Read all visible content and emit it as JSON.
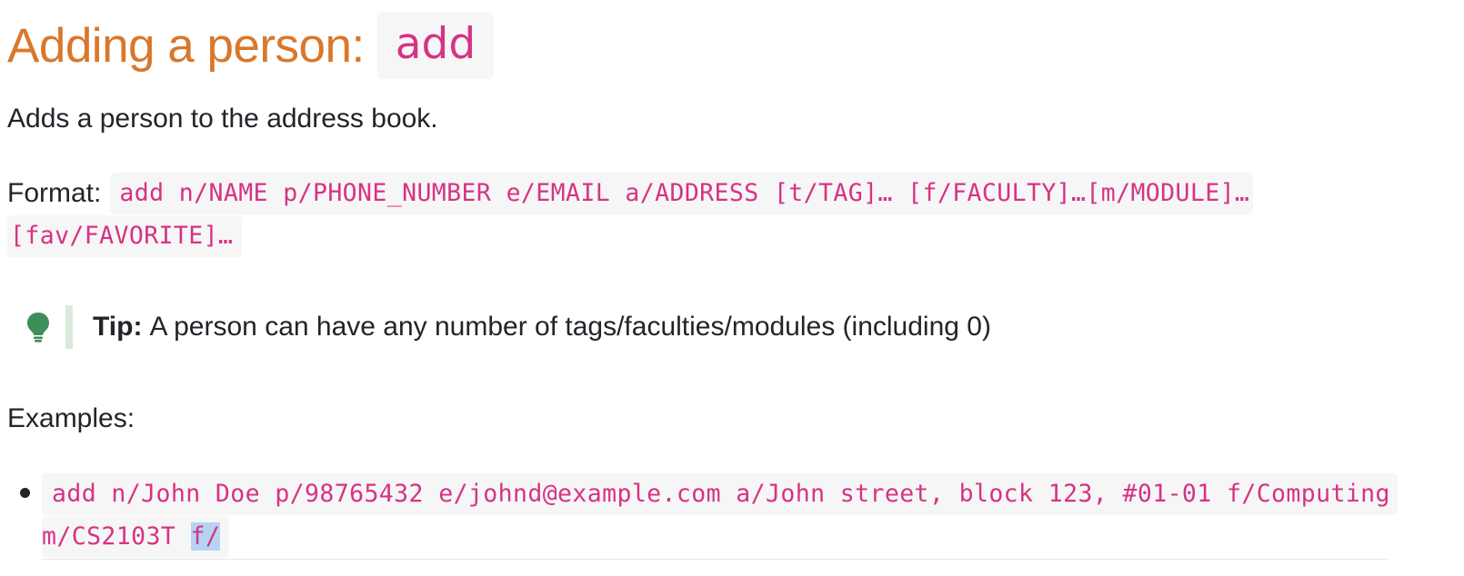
{
  "heading": {
    "text": "Adding a person:",
    "code": "add"
  },
  "intro": "Adds a person to the address book.",
  "format": {
    "label": "Format:",
    "code_line1": "add n/NAME p/PHONE_NUMBER e/EMAIL a/ADDRESS [t/TAG]… [f/FACULTY]…[m/MODULE]…",
    "code_line2": "[fav/FAVORITE]…"
  },
  "tip": {
    "icon": "lightbulb-icon",
    "label": "Tip:",
    "text": "A person can have any number of tags/faculties/modules (including 0)"
  },
  "examples": {
    "label": "Examples:",
    "items": [
      {
        "line1": "add n/John Doe p/98765432 e/johnd@example.com a/John street, block 123, #01-01 f/Computing",
        "line2_prefix": "m/CS2103T ",
        "line2_selected": "f/"
      }
    ]
  },
  "colors": {
    "heading": "#d9772b",
    "code": "#d63384",
    "code_background": "#f6f6f6",
    "tip_bar": "#d8eadc",
    "tip_icon": "#3e8f57",
    "selection": "#b7d3f3"
  }
}
